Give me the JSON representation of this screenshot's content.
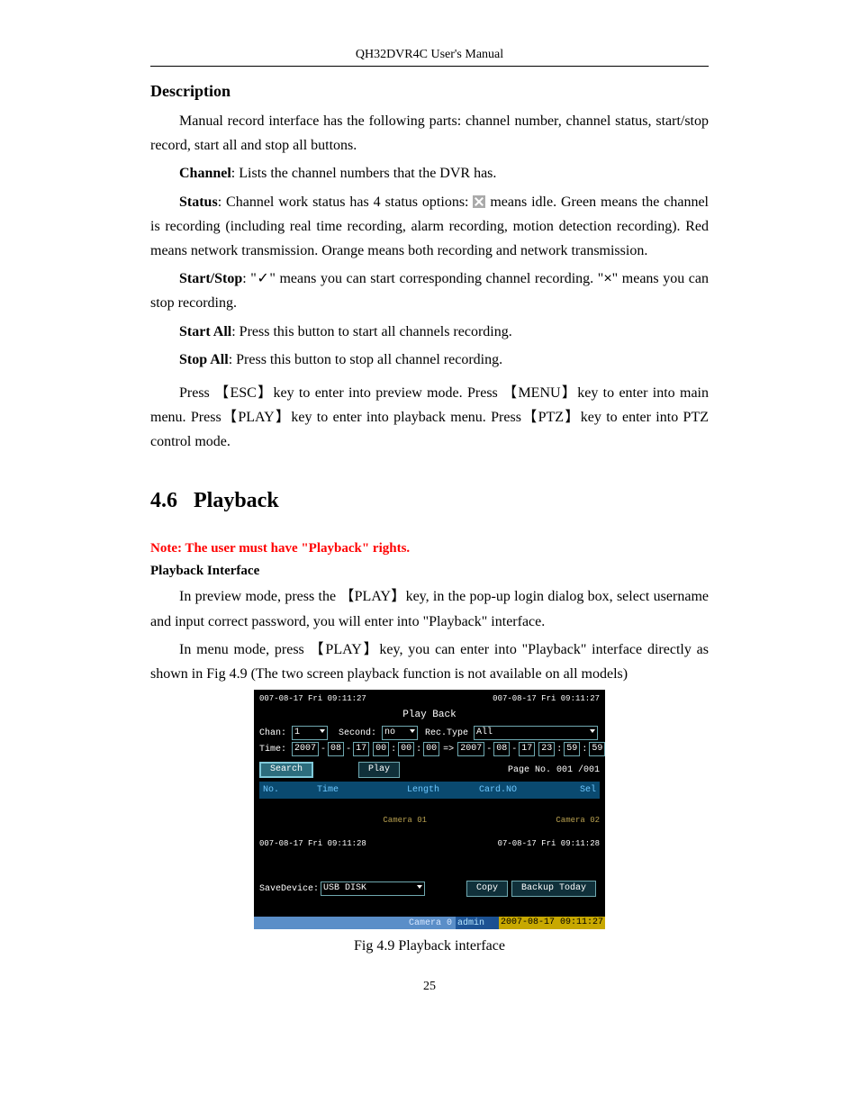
{
  "header": {
    "running": "QH32DVR4C User's Manual"
  },
  "desc": {
    "title": "Description",
    "p1": "Manual record interface has the following parts: channel number, channel status, start/stop record, start all and stop all buttons.",
    "channel_label": "Channel",
    "channel_text": ": Lists the channel numbers that the DVR has.",
    "status_label": "Status",
    "status_pre": ": Channel work status has 4 status options: ",
    "status_post": " means idle. Green means the channel is recording (including real time recording, alarm recording, motion detection recording). Red means network transmission. Orange means both recording and network transmission.",
    "startstop_label": "Start/Stop",
    "startstop_pre": ": \"",
    "startstop_check": "✓",
    "startstop_mid": "\" means you can start corresponding channel recording. \"",
    "startstop_cross": "×",
    "startstop_end": "\" means you can stop recording.",
    "startall_label": "Start All",
    "startall_text": ": Press this button to start all channels recording.",
    "stopall_label": "Stop All",
    "stopall_text": ": Press this button to stop all channel recording.",
    "keys_line": "Press 【ESC】key to enter into preview mode. Press 【MENU】key to enter into main menu. Press【PLAY】key to enter into playback menu. Press【PTZ】key to enter into PTZ control mode."
  },
  "pb": {
    "section_no": "4.6",
    "section_title": "Playback",
    "note": "Note: The user must have \"Playback\" rights.",
    "subhead": "Playback Interface",
    "p1": "In preview mode, press the 【PLAY】key, in the pop-up login dialog box, select username and input correct password, you will enter into \"Playback\" interface.",
    "p2": "In menu mode, press 【PLAY】key, you can enter into \"Playback\" interface directly as shown in Fig 4.9 (The two screen playback function is not available on all models)"
  },
  "shot": {
    "osd_top_left": "007-08-17 Fri 09:11:27",
    "osd_top_right": "007-08-17 Fri 09:11:27",
    "title": "Play Back",
    "chan_label": "Chan:",
    "chan_value": "1",
    "second_label": "Second:",
    "second_value": "no",
    "rectype_label": "Rec.Type",
    "rectype_value": "All",
    "time_label": "Time:",
    "time_from": [
      "2007",
      "08",
      "17",
      "00",
      "00",
      "00"
    ],
    "time_arrow": "=>",
    "time_to": [
      "2007",
      "08",
      "17",
      "23",
      "59",
      "59"
    ],
    "search_btn": "Search",
    "play_btn": "Play",
    "pager": "Page No. 001 /001",
    "cols": [
      "No.",
      "Time",
      "Length",
      "Card.NO",
      "Sel"
    ],
    "cam1": "Camera 01",
    "cam2": "Camera 02",
    "osd_mid_left": "007-08-17 Fri 09:11:28",
    "osd_mid_right": "07-08-17 Fri 09:11:28",
    "save_label": "SaveDevice:",
    "save_value": "USB DISK",
    "copy_btn": "Copy",
    "backup_btn": "Backup Today",
    "video_label": "Camera 0",
    "admin": "admin",
    "clock": "2007-08-17 09:11:27"
  },
  "caption": "Fig 4.9 Playback interface",
  "page_number": "25"
}
